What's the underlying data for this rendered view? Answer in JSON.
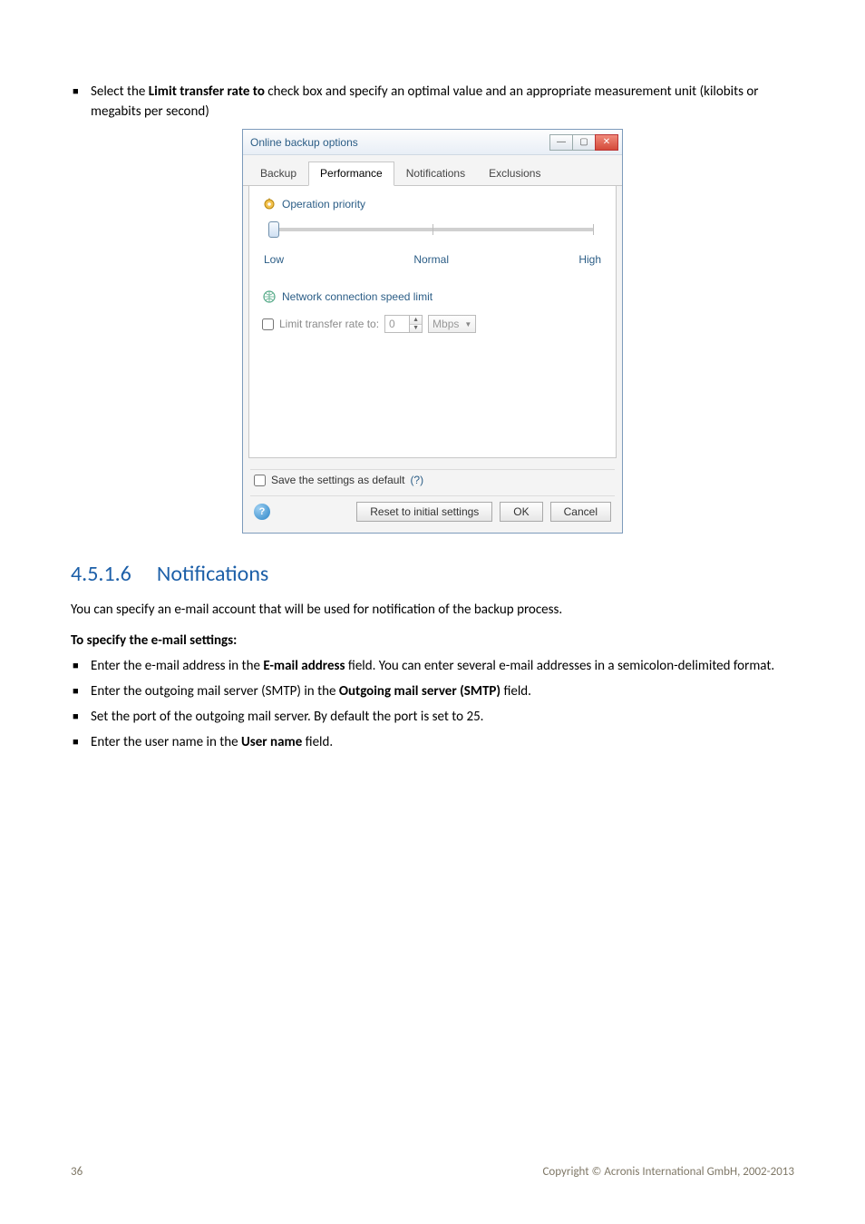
{
  "intro_bullet": {
    "pre": "Select the ",
    "bold": "Limit transfer rate to",
    "post": " check box and specify an optimal value and an appropriate measurement unit (kilobits or megabits per second)"
  },
  "dialog": {
    "title": "Online backup options",
    "tabs": {
      "t0": "Backup",
      "t1": "Performance",
      "t2": "Notifications",
      "t3": "Exclusions"
    },
    "priority": {
      "heading": "Operation priority",
      "low": "Low",
      "normal": "Normal",
      "high": "High"
    },
    "netlimit": {
      "heading": "Network connection speed limit",
      "label": "Limit transfer rate to:",
      "value": "0",
      "unit": "Mbps"
    },
    "save_default_label": "Save the settings as default",
    "save_default_help": "(?)",
    "buttons": {
      "reset": "Reset to initial settings",
      "ok": "OK",
      "cancel": "Cancel"
    }
  },
  "section": {
    "number": "4.5.1.6",
    "title": "Notifications",
    "para": "You can specify an e-mail account that will be used for notification of the backup process.",
    "subhead": "To specify the e-mail settings:",
    "b1": {
      "pre": "Enter the e-mail address in the ",
      "bold": "E-mail address",
      "post": " field. You can enter several e-mail addresses in a semicolon-delimited format."
    },
    "b2": {
      "pre": "Enter the outgoing mail server (SMTP) in the ",
      "bold": "Outgoing mail server (SMTP)",
      "post": " field."
    },
    "b3": {
      "pre": "Set the port of the outgoing mail server. By default the port is set to 25."
    },
    "b4": {
      "pre": "Enter the user name in the ",
      "bold": "User name",
      "post": " field."
    }
  },
  "footer": {
    "page": "36",
    "copy": "Copyright © Acronis International GmbH, 2002-2013"
  }
}
